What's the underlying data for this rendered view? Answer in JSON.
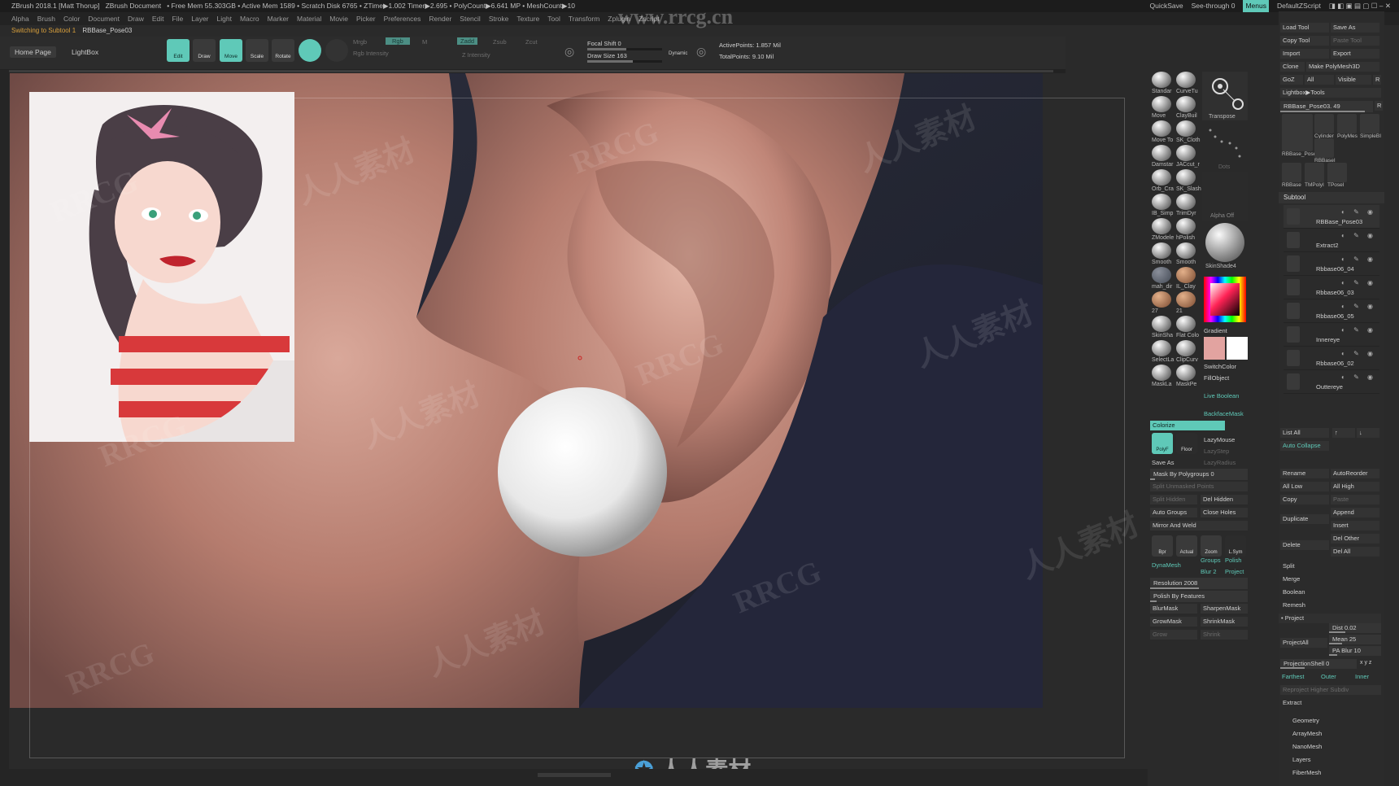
{
  "title": {
    "app": "ZBrush 2018.1 [Matt Thorup]",
    "doc": "ZBrush Document",
    "status": "• Free Mem 55.303GB • Active Mem 1589 • Scratch Disk 6765 • ZTime▶1.002 Timer▶2.695 • PolyCount▶6.641 MP • MeshCount▶10",
    "quicksave": "QuickSave",
    "seethrough": "See-through 0",
    "menus": "Menus",
    "script": "DefaultZScript"
  },
  "watermark_url": "www.rrcg.cn",
  "menubar": [
    "Alpha",
    "Brush",
    "Color",
    "Document",
    "Draw",
    "Edit",
    "File",
    "Layer",
    "Light",
    "Macro",
    "Marker",
    "Material",
    "Movie",
    "Picker",
    "Preferences",
    "Render",
    "Stencil",
    "Stroke",
    "Texture",
    "Tool",
    "Transform",
    "Zplugin",
    "Zscript"
  ],
  "notebar": {
    "msg": "Switching to Subtool 1",
    "tool": "RBBase_Pose03"
  },
  "shelf": {
    "home_page": "Home Page",
    "lightbox": "LightBox",
    "buttons": [
      "Edit",
      "Draw",
      "Move",
      "Scale",
      "Rotate"
    ],
    "mrgb": "Mrgb",
    "rgb": "Rgb",
    "m": "M",
    "zadd": "Zadd",
    "zsub": "Zsub",
    "zcut": "Zcut",
    "rgb_intensity": "Rgb Intensity",
    "z_intensity": "Z Intensity",
    "focal_shift": "Focal Shift 0",
    "draw_size": "Draw Size 163",
    "dynamic": "Dynamic",
    "active_points": "ActivePoints: 1.857 Mil",
    "total_points": "TotalPoints: 9.10 Mil"
  },
  "watermarks": [
    "RRCG",
    "人人素材",
    "RRCG",
    "人人素材",
    "RRCG",
    "人人素材",
    "RRCG",
    "人人素材",
    "RRCG",
    "人人素材",
    "RRCG",
    "人人素材"
  ],
  "bottom_watermark": "人人素材",
  "tray": {
    "brushes": [
      [
        "Standar",
        "CurveTu"
      ],
      [
        "Move",
        "ClayBuil"
      ],
      [
        "Move To",
        "SK_Cloth"
      ],
      [
        "Damstar",
        "JACcut_r"
      ],
      [
        "Orb_Cra",
        "SK_Slash"
      ],
      [
        "IB_Simp",
        "TrimDyr"
      ],
      [
        "ZModele",
        "hPolish"
      ],
      [
        "Smooth",
        "Smooth"
      ],
      [
        "mah_dir",
        "IL_Clay"
      ],
      [
        "27",
        "21"
      ],
      [
        "SkinSha",
        "Flat Colo"
      ],
      [
        "SelectLa",
        "ClipCurv"
      ],
      [
        "MaskLa",
        "MaskPe"
      ]
    ],
    "transpose": "Transpose",
    "dots": "Dots",
    "alpha_off": "Alpha Off",
    "material": "SkinShade4",
    "gradient": "Gradient",
    "switchcolor": "SwitchColor",
    "fillobject": "FillObject",
    "live_boolean": "Live Boolean",
    "backface_mask": "BackfaceMask",
    "colorize": "Colorize",
    "lazymouse": "LazyMouse",
    "lazystep": "LazyStep",
    "lazyradius": "LazyRadius",
    "polyf": "PolyF",
    "floor": "Floor",
    "save_as": "Save As",
    "mask_by_polygroups": "Mask By Polygroups 0",
    "split_unmasked": "Split Unmasked Points",
    "split_hidden": "Split Hidden",
    "del_hidden": "Del Hidden",
    "auto_groups": "Auto Groups",
    "close_holes": "Close Holes",
    "mirror_and_weld": "Mirror And Weld",
    "bpr": "Bpr",
    "actual": "Actual",
    "zoom": "Zoom",
    "lsym": "L.Sym",
    "dynamesh": "DynaMesh",
    "groups": "Groups",
    "polish": "Polish",
    "blur": "Blur 2",
    "project": "Project",
    "resolution": "Resolution 2008",
    "polish_by_features": "Polish By Features",
    "blurmask": "BlurMask",
    "sharpenmask": "SharpenMask",
    "growmask": "GrowMask",
    "shrinkmask": "ShrinkMask",
    "grow": "Grow",
    "shrink": "Shrink"
  },
  "subtool": {
    "top_buttons": [
      [
        "Load Tool",
        "Save As"
      ],
      [
        "Copy Tool",
        "Paste Tool"
      ],
      [
        "Import",
        "Export"
      ],
      [
        "Clone",
        "Make PolyMesh3D"
      ]
    ],
    "goz": "GoZ",
    "all": "All",
    "visible": "Visible",
    "r": "R",
    "lightbox_tools": "Lightbox▶Tools",
    "current_tool": "RBBase_Pose03. 49",
    "tool_thumbs": [
      "RBBase_Pose03",
      "Cylinder",
      "PolyMes",
      "SimpleBI",
      "RBBaseI",
      "RBBase",
      "TMPolyI",
      "TPoseI"
    ],
    "thumb_counts": [
      "14",
      "17",
      "14"
    ],
    "header": "Subtool",
    "items": [
      "RBBase_Pose03",
      "Extract2",
      "Rbbase06_04",
      "Rbbase06_03",
      "Rbbase06_05",
      "Innereye",
      "Rbbase06_02",
      "Outtereye"
    ],
    "list_all": "List All",
    "auto_collapse": "Auto Collapse",
    "rename": "Rename",
    "autoreorder": "AutoReorder",
    "all_low": "All Low",
    "all_high": "All High",
    "copy": "Copy",
    "paste": "Paste",
    "duplicate": "Duplicate",
    "append": "Append",
    "insert": "Insert",
    "delete": "Delete",
    "del_other": "Del Other",
    "del_all": "Del All",
    "split": "Split",
    "merge": "Merge",
    "boolean": "Boolean",
    "remesh": "Remesh",
    "project_header": "• Project",
    "projectall": "ProjectAll",
    "dist": "Dist 0.02",
    "mean": "Mean 25",
    "pablur": "PA Blur 10",
    "projectionshell": "ProjectionShell 0",
    "xyz": "x y z",
    "farthest": "Farthest",
    "outer": "Outer",
    "inner": "Inner",
    "reproject": "Reproject Higher Subdiv",
    "extract": "Extract",
    "sections": [
      "Geometry",
      "ArrayMesh",
      "NanoMesh",
      "Layers",
      "FiberMesh"
    ]
  }
}
